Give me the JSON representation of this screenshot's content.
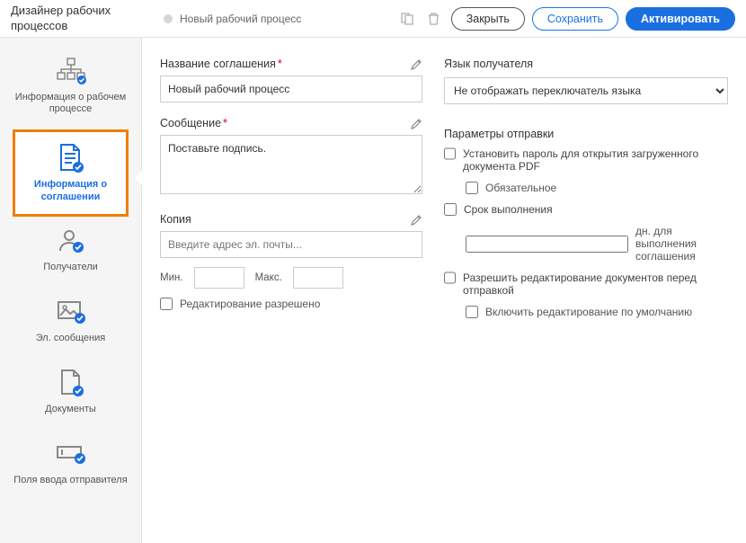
{
  "header": {
    "app_title": "Дизайнер рабочих процессов",
    "workflow_name": "Новый рабочий процесс",
    "close_label": "Закрыть",
    "save_label": "Сохранить",
    "activate_label": "Активировать"
  },
  "sidebar": {
    "items": [
      {
        "id": "workflow-info",
        "label": "Информация о рабочем процессе",
        "active": false
      },
      {
        "id": "agreement-info",
        "label": "Информация о соглашении",
        "active": true
      },
      {
        "id": "recipients",
        "label": "Получатели",
        "active": false
      },
      {
        "id": "emails",
        "label": "Эл. сообщения",
        "active": false
      },
      {
        "id": "documents",
        "label": "Документы",
        "active": false
      },
      {
        "id": "sender-fields",
        "label": "Поля ввода отправителя",
        "active": false
      }
    ]
  },
  "form": {
    "agreement_name_label": "Название соглашения",
    "agreement_name_value": "Новый рабочий процесс",
    "message_label": "Сообщение",
    "message_value": "Поставьте подпись.",
    "cc_label": "Копия",
    "cc_placeholder": "Введите адрес эл. почты...",
    "min_label": "Мин.",
    "max_label": "Макс.",
    "editing_allowed_label": "Редактирование разрешено",
    "recipient_lang_label": "Язык получателя",
    "recipient_lang_value": "Не отображать переключатель языка",
    "send_options_label": "Параметры отправки",
    "opt_password_label": "Установить пароль для открытия загруженного документа PDF",
    "opt_required_label": "Обязательное",
    "opt_deadline_label": "Срок выполнения",
    "opt_deadline_suffix": "дн. для выполнения соглашения",
    "opt_allow_edit_label": "Разрешить редактирование документов перед отправкой",
    "opt_default_edit_label": "Включить редактирование по умолчанию"
  }
}
